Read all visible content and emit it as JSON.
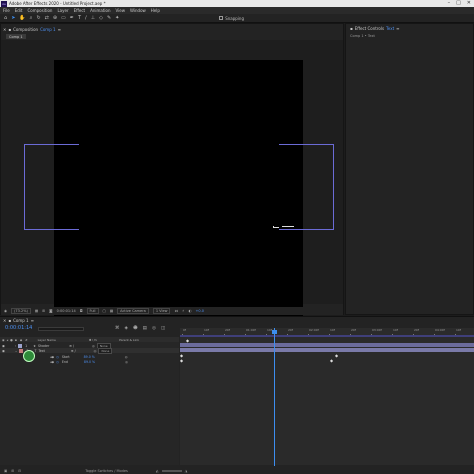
{
  "window": {
    "title": "Adobe After Effects 2020 - Untitled Project.aep *",
    "app_icon": "Ae",
    "controls": [
      "–",
      "□",
      "✕"
    ]
  },
  "menu": [
    "File",
    "Edit",
    "Composition",
    "Layer",
    "Effect",
    "Animation",
    "View",
    "Window",
    "Help"
  ],
  "toolbar": {
    "tools": [
      "home-icon",
      "selection-icon",
      "hand-icon",
      "zoom-icon",
      "orbit-icon",
      "track-icon",
      "pan-icon",
      "rect-icon",
      "pen-icon",
      "type-icon",
      "brush-icon",
      "stamp-icon",
      "eraser-icon",
      "roto-icon",
      "puppet-icon"
    ],
    "snapping_label": "Snapping"
  },
  "composition": {
    "tab_label": "Composition",
    "comp_name": "Comp 1",
    "sub_tab": "Comp 1",
    "footer": {
      "zoom": "(73.2%)",
      "timecode": "0:00:01:14",
      "resolution": "Full",
      "camera": "Active Camera",
      "views": "1 View",
      "offset": "+0.0"
    }
  },
  "effect_controls": {
    "tab_label": "Effect Controls",
    "layer_name": "Text",
    "breadcrumb": "Comp 1 • Text"
  },
  "timeline": {
    "tab_label": "Comp 1",
    "current_time": "0:00:01:14",
    "columns": {
      "layer_name": "Layer Name",
      "parent": "Parent & Link"
    },
    "layers": [
      {
        "index": "1",
        "name": "Shader",
        "parent": "None"
      },
      {
        "index": "2",
        "name": "Text",
        "parent": "None"
      }
    ],
    "properties": [
      {
        "name": "Start",
        "value": "89.0 %"
      },
      {
        "name": "End",
        "value": "89.0 %"
      }
    ],
    "ruler_labels": [
      "0f",
      "10f",
      "20f",
      "01:00f",
      "10f",
      "20f",
      "02:00f",
      "10f",
      "20f",
      "03:00f",
      "10f",
      "20f",
      "04:00f",
      "10f"
    ],
    "footer_label": "Toggle Switches / Modes"
  },
  "colors": {
    "accent_blue": "#3d8ef0",
    "guide_purple": "#6b6bd6",
    "bar_purple": "#6b6b9c"
  }
}
